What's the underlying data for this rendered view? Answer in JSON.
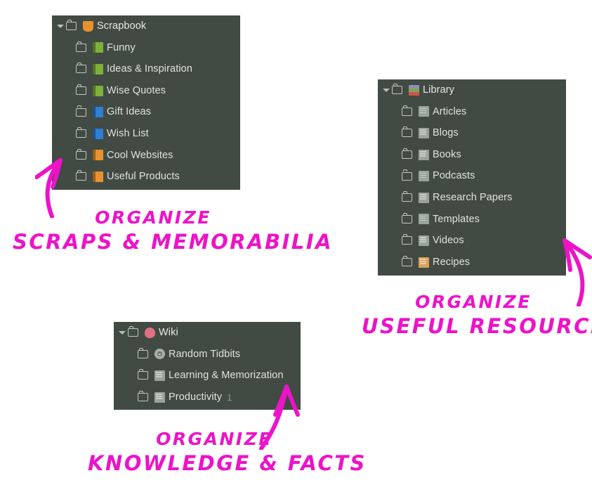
{
  "page": {
    "background": "#ffffff",
    "panel_background": "#414a43",
    "annotation_color": "#ec13c8",
    "label_color": "#dfe3e0"
  },
  "panels": [
    {
      "name": "scrapbook",
      "root": {
        "label": "Scrapbook",
        "icon": "autumn-leaf-emoji",
        "icon_color": "#e8922f",
        "expanded": true
      },
      "children": [
        {
          "label": "Funny",
          "icon": "green-book-emoji",
          "icon_color": "#7fb03a"
        },
        {
          "label": "Ideas & Inspiration",
          "icon": "green-book-emoji",
          "icon_color": "#7fb03a"
        },
        {
          "label": "Wise Quotes",
          "icon": "green-book-emoji",
          "icon_color": "#7fb03a"
        },
        {
          "label": "Gift Ideas",
          "icon": "blue-book-emoji",
          "icon_color": "#2f7fd4"
        },
        {
          "label": "Wish List",
          "icon": "blue-book-emoji",
          "icon_color": "#2f7fd4"
        },
        {
          "label": "Cool Websites",
          "icon": "orange-book-emoji",
          "icon_color": "#e8922f"
        },
        {
          "label": "Useful Products",
          "icon": "orange-book-emoji",
          "icon_color": "#e8922f"
        }
      ]
    },
    {
      "name": "library",
      "root": {
        "label": "Library",
        "icon": "books-stack-emoji",
        "icon_color": "#c6556a",
        "expanded": true
      },
      "children": [
        {
          "label": "Articles",
          "icon": "newspaper-emoji",
          "icon_color": "#9aa39d"
        },
        {
          "label": "Blogs",
          "icon": "newspaper-emoji",
          "icon_color": "#9aa39d"
        },
        {
          "label": "Books",
          "icon": "newspaper-emoji",
          "icon_color": "#9aa39d"
        },
        {
          "label": "Podcasts",
          "icon": "newspaper-emoji",
          "icon_color": "#9aa39d"
        },
        {
          "label": "Research Papers",
          "icon": "newspaper-emoji",
          "icon_color": "#9aa39d"
        },
        {
          "label": "Templates",
          "icon": "newspaper-emoji",
          "icon_color": "#9aa39d"
        },
        {
          "label": "Videos",
          "icon": "newspaper-emoji",
          "icon_color": "#9aa39d"
        },
        {
          "label": "Recipes",
          "icon": "card-index-emoji",
          "icon_color": "#d9a15c"
        }
      ]
    },
    {
      "name": "wiki",
      "root": {
        "label": "Wiki",
        "icon": "brain-emoji",
        "icon_color": "#e2717f",
        "expanded": true
      },
      "children": [
        {
          "label": "Random Tidbits",
          "icon": "dart-board-emoji",
          "icon_color": "#a9b0ab"
        },
        {
          "label": "Learning & Memorization",
          "icon": "newspaper-emoji",
          "icon_color": "#9aa39d"
        },
        {
          "label": "Productivity",
          "icon": "newspaper-emoji",
          "icon_color": "#9aa39d",
          "count": "1"
        }
      ]
    }
  ],
  "annotations": [
    {
      "name": "scrapbook-note",
      "line1": "Organize",
      "line2": "Scraps & Memorabilia"
    },
    {
      "name": "library-note",
      "line1": "Organize",
      "line2": "Useful Resources"
    },
    {
      "name": "wiki-note",
      "line1": "Organize",
      "line2": "Knowledge & Facts"
    }
  ]
}
